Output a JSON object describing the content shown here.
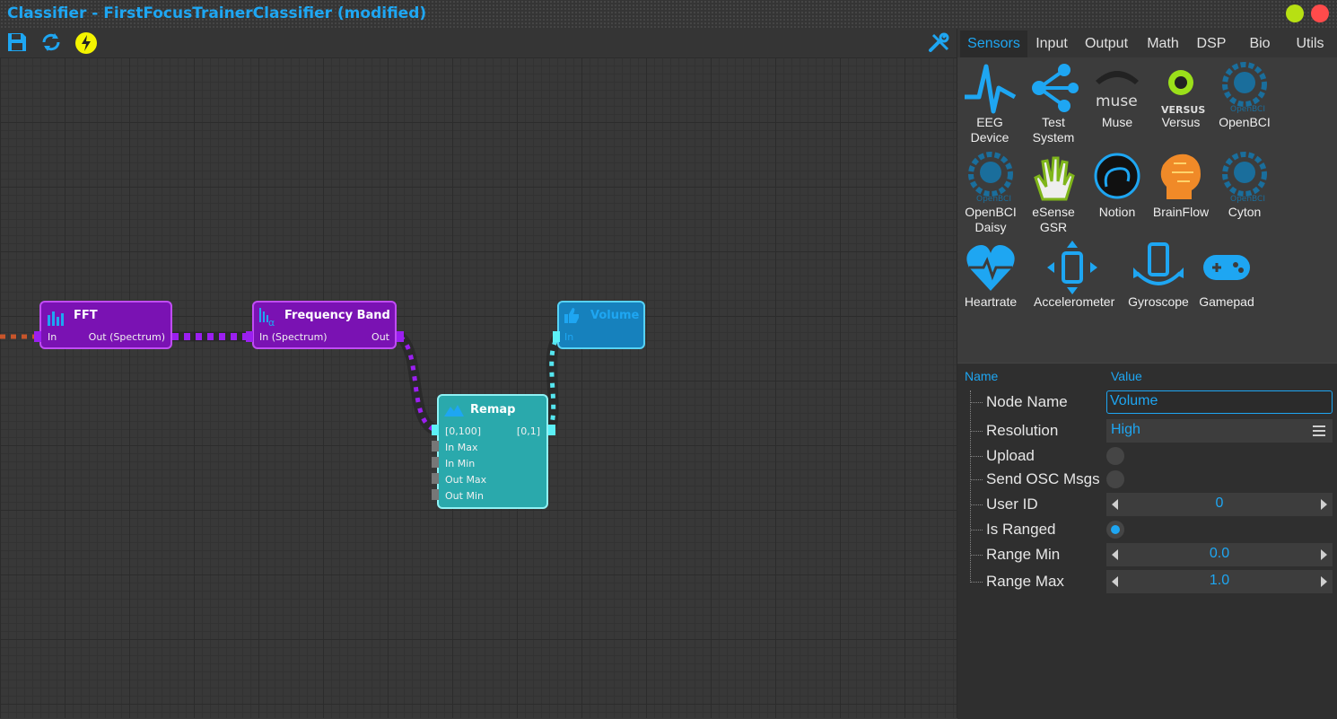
{
  "window": {
    "title": "Classifier - FirstFocusTrainerClassifier (modified)",
    "accent": "#1ea6f2"
  },
  "toolbar": {
    "icons": [
      "save-icon",
      "refresh-icon",
      "lightning-icon",
      "wrench-icon"
    ]
  },
  "graph": {
    "nodes": {
      "fft": {
        "title": "FFT",
        "in": "In",
        "out": "Out (Spectrum)",
        "color": "#8a1fc7"
      },
      "frequency_band": {
        "title": "Frequency Band",
        "in": "In (Spectrum)",
        "out": "Out",
        "icon_glyph": "α",
        "color": "#8a1fc7"
      },
      "remap": {
        "title": "Remap",
        "in": "[0,100]",
        "out": "[0,1]",
        "ports": [
          "In Max",
          "In Min",
          "Out Max",
          "Out Min"
        ],
        "color": "#2fb8bb"
      },
      "volume": {
        "title": "Volume",
        "in": "In",
        "color": "#1d88c7"
      }
    }
  },
  "tabs": [
    {
      "label": "Sensors",
      "active": true
    },
    {
      "label": "Input"
    },
    {
      "label": "Output"
    },
    {
      "label": "Math"
    },
    {
      "label": "DSP"
    },
    {
      "label": "Bio"
    },
    {
      "label": "Utils"
    }
  ],
  "palette": [
    {
      "label1": "EEG",
      "label2": "Device",
      "icon": "eeg-wave-icon"
    },
    {
      "label1": "Test",
      "label2": "System",
      "icon": "network-icon"
    },
    {
      "label1": "Muse",
      "label2": "",
      "icon": "muse-logo-icon",
      "logo_text": "muse"
    },
    {
      "label1": "Versus",
      "label2": "",
      "icon": "versus-logo-icon",
      "logo_text": "VERSUS"
    },
    {
      "label1": "OpenBCI",
      "label2": "",
      "icon": "openbci-gear-icon",
      "logo_text": "OpenBCI"
    },
    {
      "label1": "OpenBCI",
      "label2": "Daisy",
      "icon": "openbci-gear-icon",
      "logo_text": "OpenBCI"
    },
    {
      "label1": "eSense",
      "label2": "GSR",
      "icon": "hand-icon"
    },
    {
      "label1": "Notion",
      "label2": "",
      "icon": "notion-icon"
    },
    {
      "label1": "BrainFlow",
      "label2": "",
      "icon": "brain-head-icon"
    },
    {
      "label1": "Cyton",
      "label2": "",
      "icon": "openbci-gear-icon",
      "logo_text": "OpenBCI"
    },
    {
      "label1": "Heartrate",
      "label2": "",
      "icon": "heart-icon"
    },
    {
      "label1": "Accelerometer",
      "label2": "",
      "icon": "phone-arrows-icon"
    },
    {
      "label1": "Gyroscope",
      "label2": "",
      "icon": "phone-rotate-icon"
    },
    {
      "label1": "Gamepad",
      "label2": "",
      "icon": "gamepad-icon"
    }
  ],
  "properties": {
    "col_name": "Name",
    "col_value": "Value",
    "rows": [
      {
        "name": "Node Name",
        "type": "text",
        "value": "Volume"
      },
      {
        "name": "Resolution",
        "type": "select",
        "value": "High"
      },
      {
        "name": "Upload",
        "type": "checkbox",
        "value": false
      },
      {
        "name": "Send OSC Msgs",
        "type": "checkbox",
        "value": false
      },
      {
        "name": "User ID",
        "type": "spin",
        "value": "0"
      },
      {
        "name": "Is Ranged",
        "type": "checkbox",
        "value": true
      },
      {
        "name": "Range Min",
        "type": "spin",
        "value": "0.0"
      },
      {
        "name": "Range Max",
        "type": "spin",
        "value": "1.0"
      }
    ]
  }
}
